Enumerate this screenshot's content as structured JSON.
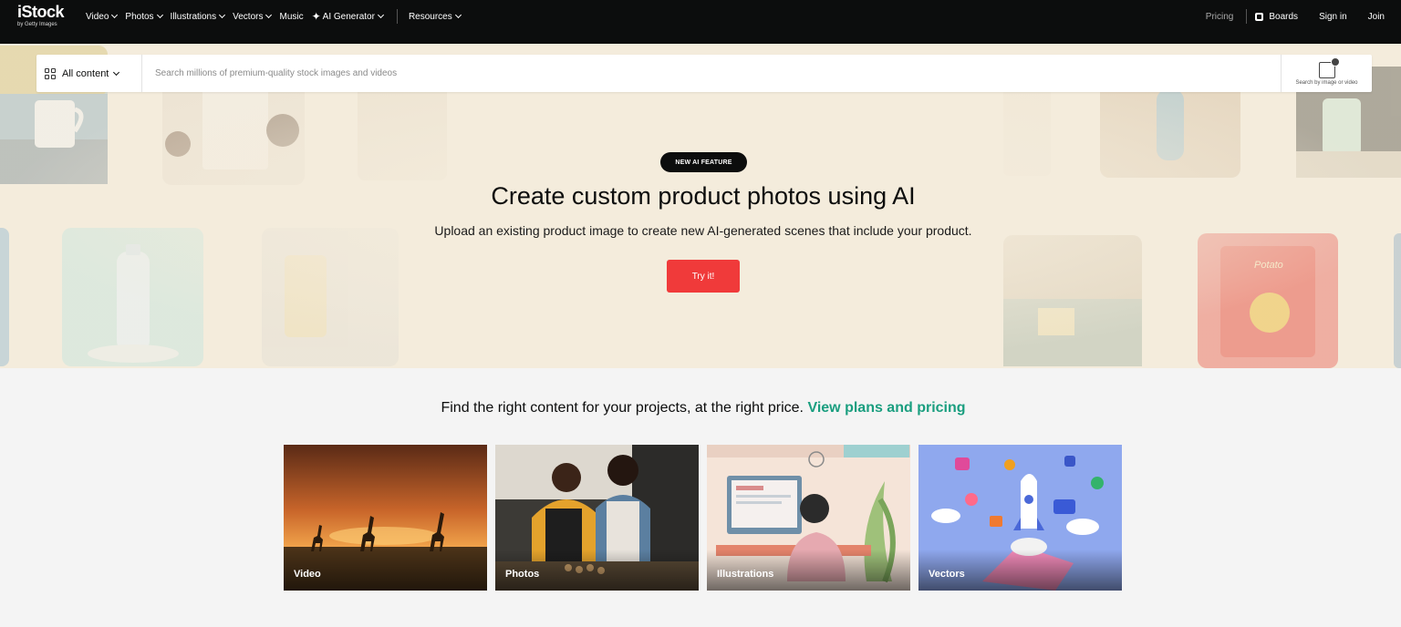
{
  "nav": {
    "logo": "iStock",
    "logo_sub": "by Getty Images",
    "items": [
      {
        "label": "Video",
        "dropdown": true
      },
      {
        "label": "Photos",
        "dropdown": true
      },
      {
        "label": "Illustrations",
        "dropdown": true
      },
      {
        "label": "Vectors",
        "dropdown": true
      },
      {
        "label": "Music",
        "dropdown": false
      },
      {
        "label": "AI Generator",
        "dropdown": true,
        "icon": "sparkle-icon"
      },
      {
        "label": "Resources",
        "dropdown": true
      }
    ],
    "right": {
      "pricing": "Pricing",
      "boards": "Boards",
      "signin": "Sign in",
      "join": "Join"
    }
  },
  "search": {
    "category": "All content",
    "placeholder": "Search millions of premium-quality stock images and videos",
    "image_search_label": "Search by image or video"
  },
  "hero": {
    "badge": "NEW AI FEATURE",
    "title": "Create custom product photos using AI",
    "subtitle": "Upload an existing product image to create new AI-generated scenes that include your product.",
    "cta": "Try it!",
    "background_color": "#f4ecdc"
  },
  "content": {
    "plans_text": "Find the right content for your projects, at the right price.",
    "plans_link": "View plans and pricing",
    "link_color": "#1a9e7f",
    "cards": [
      {
        "label": "Video"
      },
      {
        "label": "Photos"
      },
      {
        "label": "Illustrations"
      },
      {
        "label": "Vectors"
      }
    ]
  },
  "colors": {
    "nav_bg": "#0c0d0d",
    "cta": "#f03a3a",
    "page_bg": "#f4f4f4"
  }
}
